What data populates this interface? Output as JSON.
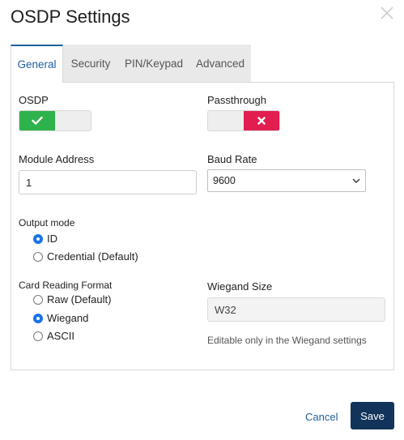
{
  "dialog": {
    "title": "OSDP Settings"
  },
  "tabs": [
    {
      "label": "General",
      "active": true
    },
    {
      "label": "Security",
      "active": false
    },
    {
      "label": "PIN/Keypad",
      "active": false
    },
    {
      "label": "Advanced",
      "active": false
    }
  ],
  "general": {
    "osdp": {
      "label": "OSDP",
      "state": "on"
    },
    "passthrough": {
      "label": "Passthrough",
      "state": "off"
    },
    "module_address": {
      "label": "Module Address",
      "value": "1"
    },
    "baud_rate": {
      "label": "Baud Rate",
      "value": "9600"
    },
    "output_mode": {
      "label": "Output mode",
      "options": [
        {
          "label": "ID",
          "checked": true
        },
        {
          "label": "Credential (Default)",
          "checked": false
        }
      ]
    },
    "card_reading_format": {
      "label": "Card Reading Format",
      "options": [
        {
          "label": "Raw (Default)",
          "checked": false
        },
        {
          "label": "Wiegand",
          "checked": true
        },
        {
          "label": "ASCII",
          "checked": false
        }
      ]
    },
    "wiegand_size": {
      "label": "Wiegand Size",
      "value": "W32",
      "hint": "Editable only in the Wiegand settings"
    }
  },
  "footer": {
    "cancel_label": "Cancel",
    "save_label": "Save"
  },
  "colors": {
    "accent": "#1f5f9b",
    "toggle_on": "#2eb34c",
    "toggle_off": "#e11e4f",
    "save_button": "#12345a",
    "radio_checked": "#1a73e8"
  },
  "icons": {
    "close": "close-icon",
    "check": "check-icon",
    "cross": "cross-icon",
    "chevron": "chevron-down-icon"
  }
}
